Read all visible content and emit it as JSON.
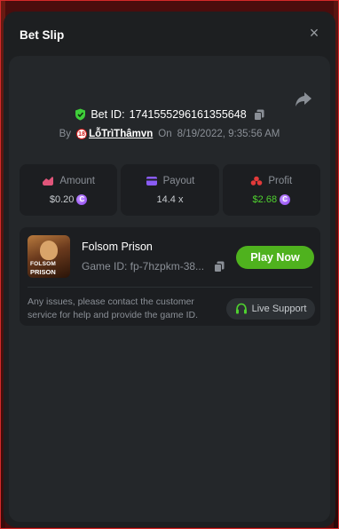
{
  "modal": {
    "title": "Bet Slip",
    "close_label": "×"
  },
  "bet": {
    "id_label": "Bet ID:",
    "id_value": "1741555296161355648",
    "by_label": "By",
    "user": "LỗTrìThâmvn",
    "age_badge": "18",
    "on_label": "On",
    "date": "8/19/2022, 9:35:56 AM"
  },
  "stats": [
    {
      "label": "Amount",
      "value": "$0.20",
      "has_coin": true,
      "icon": "amount-icon",
      "color": "#e0557a"
    },
    {
      "label": "Payout",
      "value": "14.4 x",
      "has_coin": false,
      "icon": "payout-icon",
      "color": "#8a5cf5"
    },
    {
      "label": "Profit",
      "value": "$2.68",
      "has_coin": true,
      "icon": "profit-icon",
      "color": "#e23a3a"
    }
  ],
  "game": {
    "name": "Folsom Prison",
    "id_text": "Game ID: fp-7hzpkm-38...",
    "thumb_line1": "FOLSOM",
    "thumb_line2": "PRISON",
    "play_label": "Play Now"
  },
  "support": {
    "text": "Any issues, please contact the customer service for help and provide the game ID.",
    "button_label": "Live Support"
  },
  "colors": {
    "accent_green": "#4fb21e",
    "profit_green": "#4fd12f",
    "coin_purple": "#8a3cf0"
  }
}
